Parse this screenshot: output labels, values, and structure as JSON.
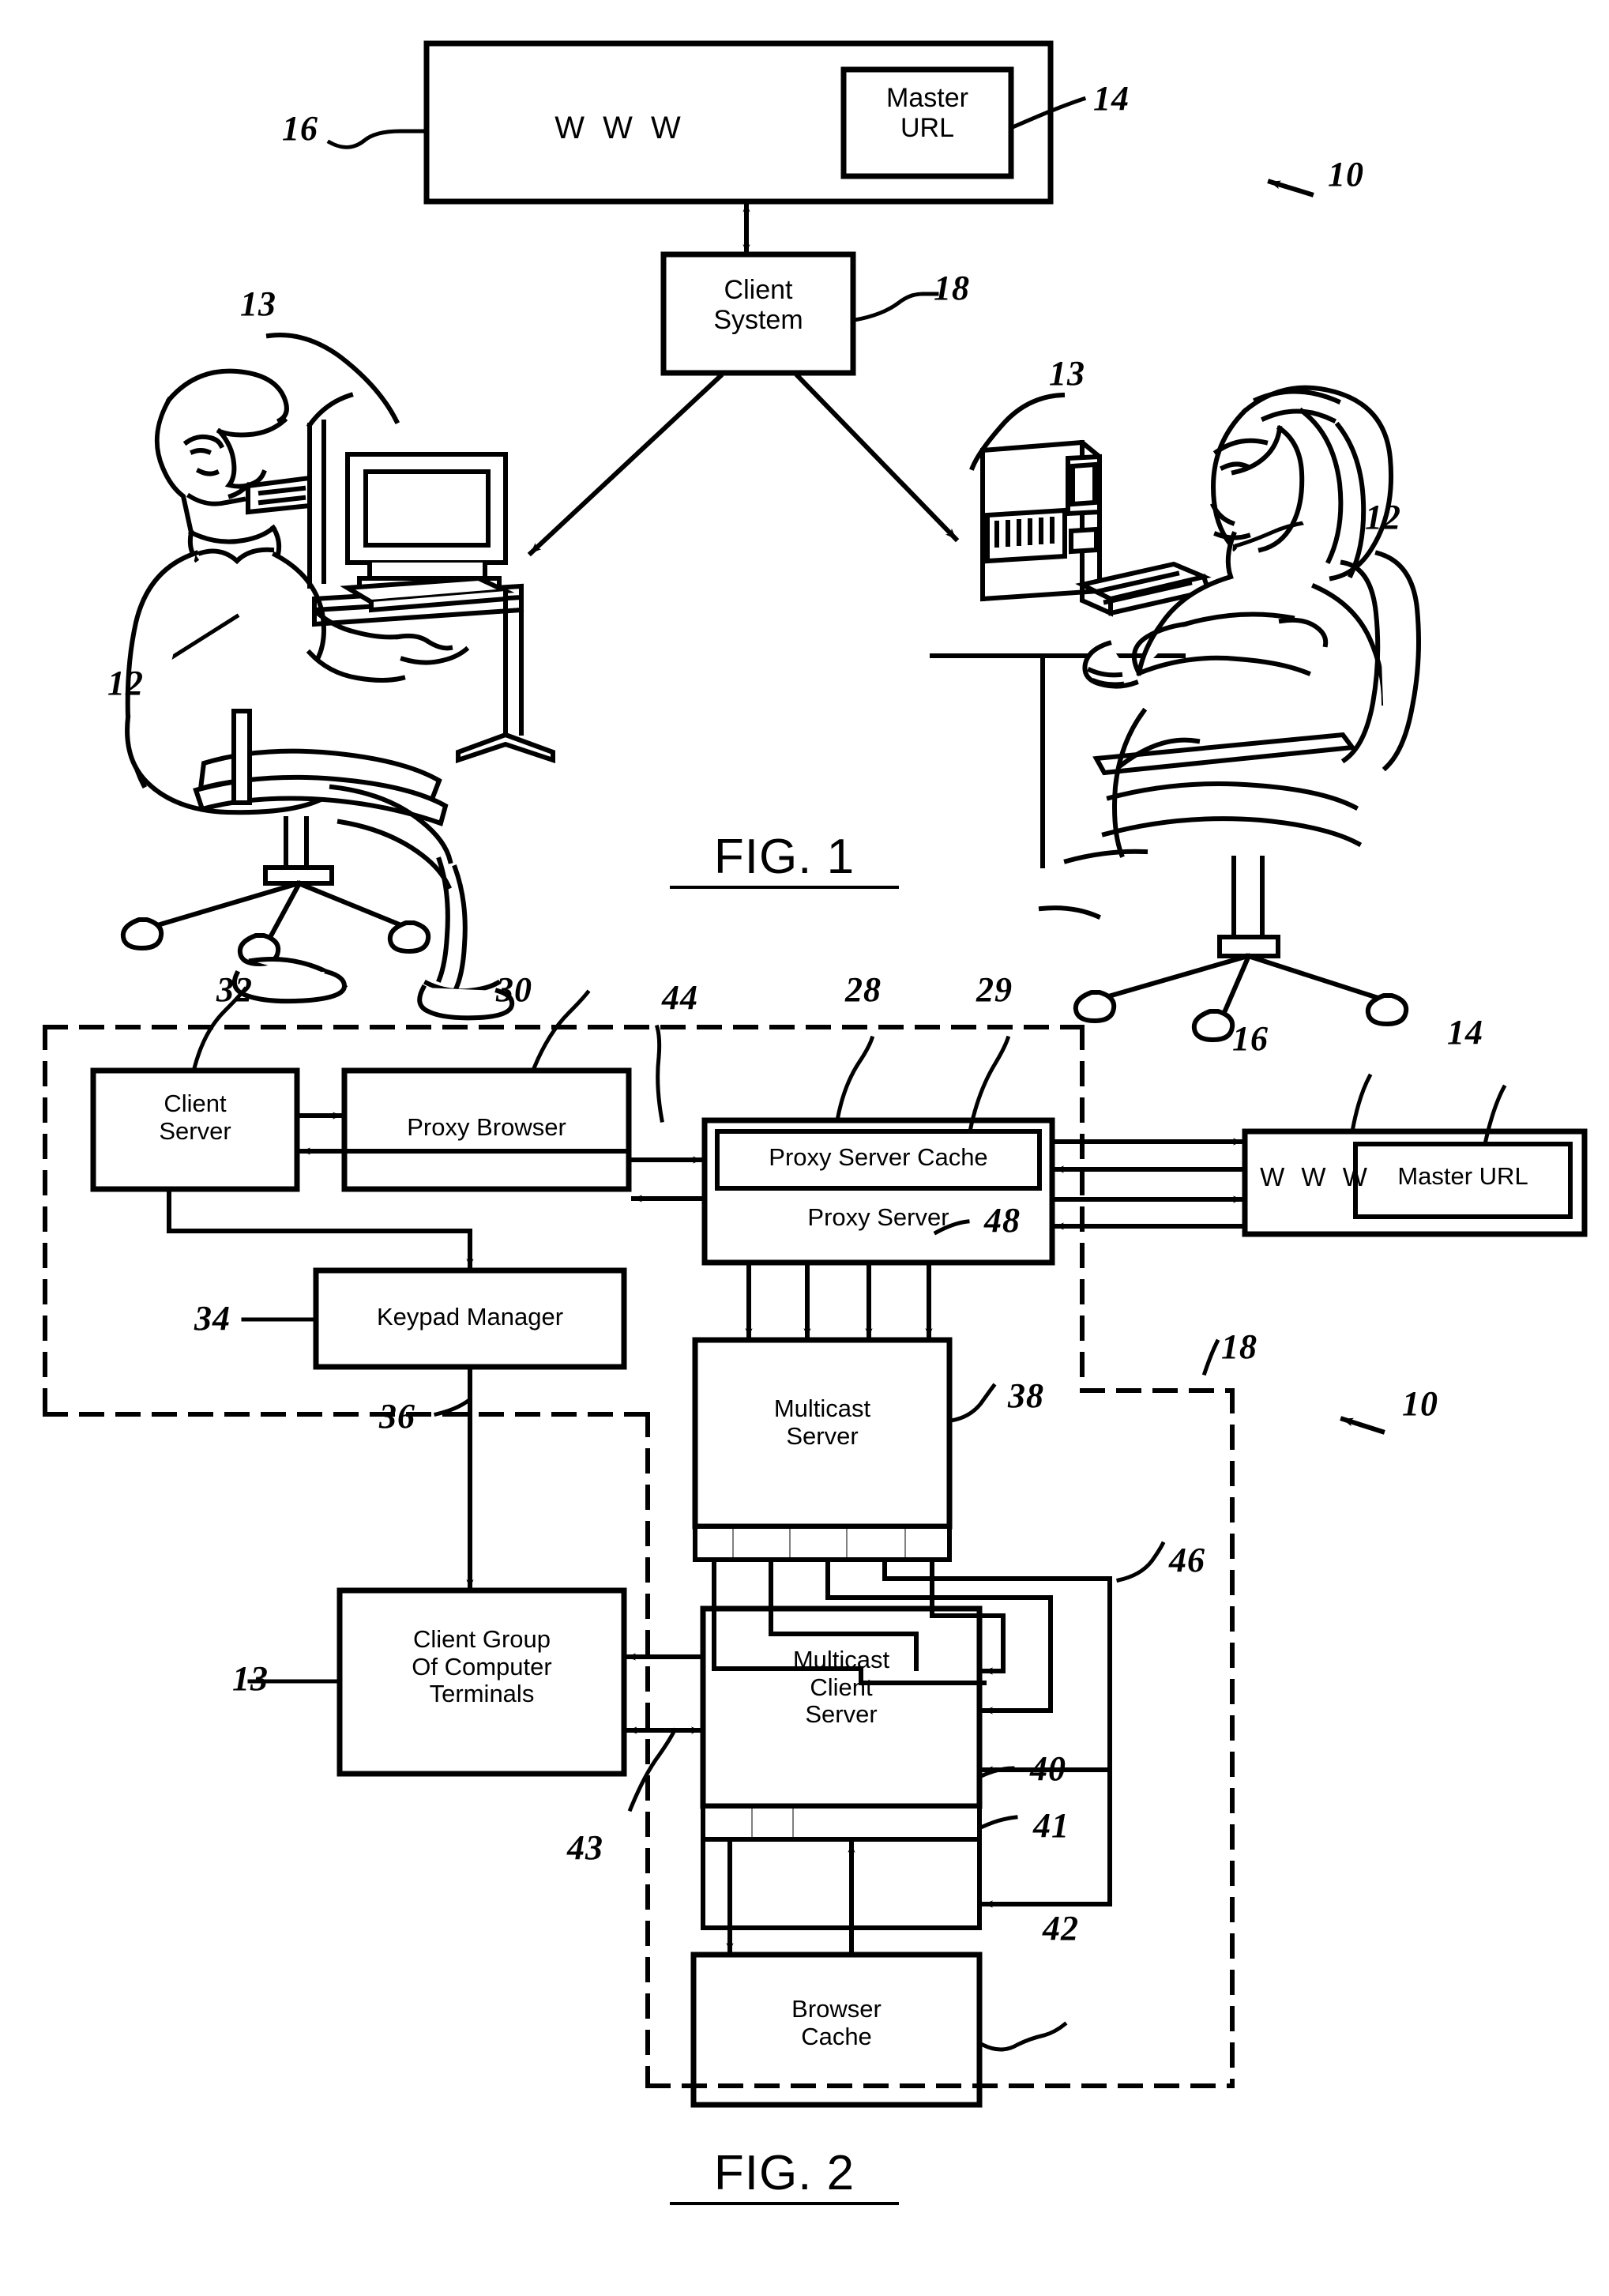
{
  "document": {
    "type": "patent-drawing-sheet",
    "figures": [
      "FIG. 1",
      "FIG. 2"
    ]
  },
  "fig1": {
    "caption": "FIG. 1",
    "boxes": {
      "www": "W W W",
      "master_url": "Master\nURL",
      "client_system": "Client\nSystem"
    },
    "refs": {
      "www": "16",
      "master_url": "14",
      "system": "10",
      "client_system": "18",
      "terminal_left": "13",
      "terminal_right": "13",
      "user_left": "12",
      "user_right": "12"
    }
  },
  "fig2": {
    "caption": "FIG. 2",
    "boxes": {
      "client_server": "Client\nServer",
      "proxy_browser": "Proxy Browser",
      "proxy_server_cache": "Proxy Server Cache",
      "proxy_server": "Proxy Server",
      "www": "W W W",
      "master_url": "Master URL",
      "keypad_manager": "Keypad Manager",
      "multicast_server": "Multicast\nServer",
      "client_group": "Client Group\nOf Computer\nTerminals",
      "multicast_client_server": "Multicast\nClient\nServer",
      "browser_cache": "Browser\nCache"
    },
    "refs": {
      "client_server": "32",
      "proxy_browser": "30",
      "link_44": "44",
      "proxy_server": "28",
      "proxy_server_cache": "29",
      "www": "16",
      "master_url": "14",
      "keypad_manager": "34",
      "link_36": "36",
      "link_48": "48",
      "multicast_server": "38",
      "client_system": "18",
      "system": "10",
      "link_46": "46",
      "client_group": "13",
      "link_40": "40",
      "link_41": "41",
      "link_43": "43",
      "browser_cache": "42"
    }
  },
  "colors": {
    "ink": "#000000",
    "paper": "#ffffff"
  }
}
